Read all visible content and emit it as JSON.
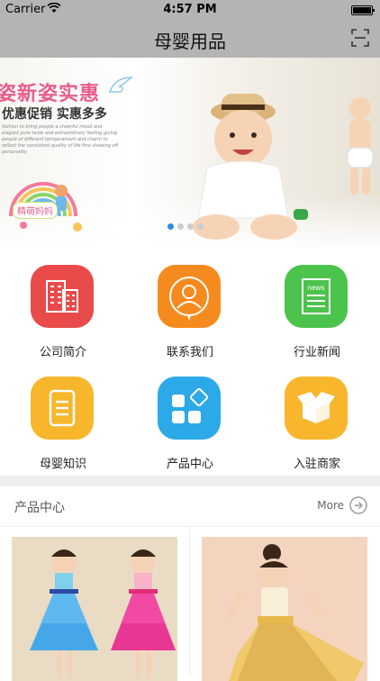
{
  "status": {
    "carrier": "Carrier",
    "time": "4:57 PM"
  },
  "nav": {
    "title": "母婴用品"
  },
  "banner": {
    "headline": "姿新姿实惠",
    "subline": "优惠促销 实惠多多",
    "body_text": "fashion to bring people a cheerful mood and elegant pure taste and extraordinary feeling giving people of different temperament and charm to reflect the consistent quality of life fine showing off personality",
    "badge": "精萌妈妈"
  },
  "menu": [
    {
      "label": "公司简介",
      "color": "#e94b4b",
      "icon": "building-icon"
    },
    {
      "label": "联系我们",
      "color": "#f58a1f",
      "icon": "contact-person-icon"
    },
    {
      "label": "行业新闻",
      "color": "#4cc34c",
      "icon": "news-icon"
    },
    {
      "label": "母婴知识",
      "color": "#f8b62c",
      "icon": "document-icon"
    },
    {
      "label": "产品中心",
      "color": "#2ca9e8",
      "icon": "apps-icon"
    },
    {
      "label": "入驻商家",
      "color": "#f8b62c",
      "icon": "box-icon"
    }
  ],
  "products_section": {
    "title": "产品中心",
    "more": "More"
  }
}
